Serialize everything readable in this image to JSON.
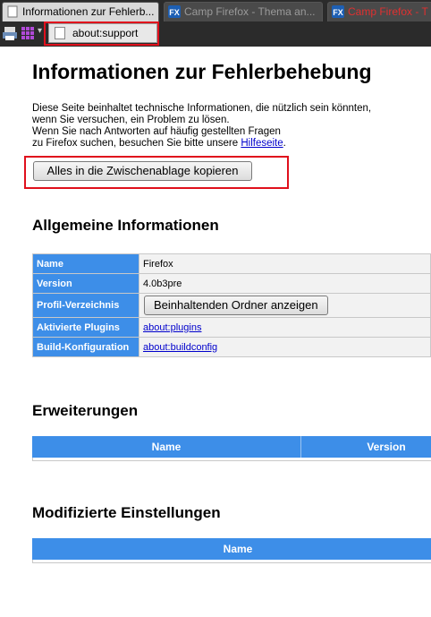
{
  "tabs": [
    {
      "label": "Informationen zur Fehlerb...",
      "state": "active"
    },
    {
      "label": "Camp Firefox - Thema an...",
      "state": "inactive"
    },
    {
      "label": "Camp Firefox - T",
      "state": "inactive"
    }
  ],
  "urlbar": {
    "value": "about:support"
  },
  "page": {
    "title": "Informationen zur Fehlerbehebung",
    "intro_line1": "Diese Seite beinhaltet technische Informationen, die nützlich sein könnten,",
    "intro_line2": "wenn Sie versuchen, ein Problem zu lösen.",
    "intro_line3": "Wenn Sie nach Antworten auf häufig gestellten Fragen",
    "intro_line4_prefix": "zu Firefox suchen, besuchen Sie bitte unsere ",
    "intro_link": "Hilfeseite",
    "intro_line4_suffix": ".",
    "copy_button": "Alles in die Zwischenablage kopieren"
  },
  "general": {
    "heading": "Allgemeine Informationen",
    "rows": [
      {
        "label": "Name",
        "value": "Firefox"
      },
      {
        "label": "Version",
        "value": "4.0b3pre"
      },
      {
        "label": "Profil-Verzeichnis",
        "button": "Beinhaltenden Ordner anzeigen"
      },
      {
        "label": "Aktivierte Plugins",
        "link": "about:plugins"
      },
      {
        "label": "Build-Konfiguration",
        "link": "about:buildconfig"
      }
    ]
  },
  "extensions": {
    "heading": "Erweiterungen",
    "columns": [
      "Name",
      "Version"
    ]
  },
  "prefs": {
    "heading": "Modifizierte Einstellungen",
    "columns": [
      "Name"
    ]
  },
  "colors": {
    "accent": "#3d8ee8",
    "highlight": "#e0101c",
    "chrome": "#2b2b2b"
  },
  "icons": [
    "page-icon",
    "firefox-fx-icon",
    "print-icon",
    "grid-icon"
  ]
}
